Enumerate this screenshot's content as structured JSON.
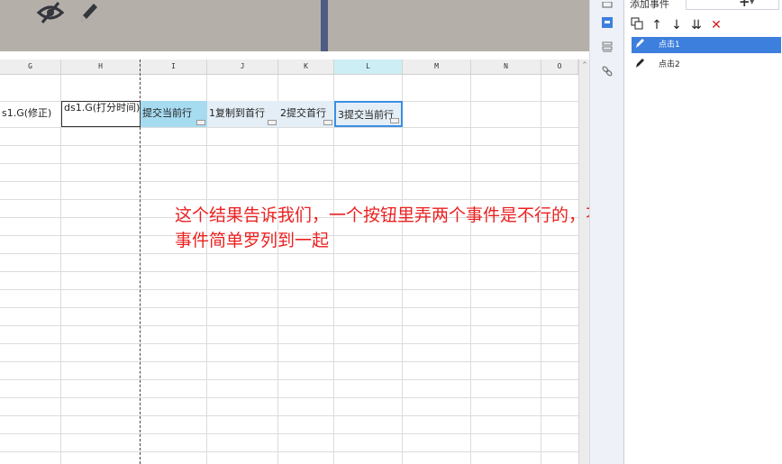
{
  "toolbar": {
    "icons": [
      "eye-slash-icon",
      "pencil-icon"
    ]
  },
  "grid": {
    "columns": [
      "G",
      "H",
      "I",
      "J",
      "K",
      "L",
      "M",
      "N",
      "O"
    ],
    "active_column": "L",
    "cells": {
      "G": "s1.G(修正)",
      "H": "ds1.G(打分时间)",
      "I": "提交当前行",
      "J": "1复制到首行",
      "K": "2提交首行",
      "L": "3提交当前行"
    }
  },
  "annotation": {
    "text": "这个结果告诉我们，一个按钮里弄两个事件是不行的，不能这么简单的把这两个事件简单罗列到一起"
  },
  "side_icons": [
    "panel-icon",
    "event-icon",
    "layers-icon",
    "link-icon"
  ],
  "event_panel": {
    "title": "添加事件",
    "add_label": "+",
    "toolbar_icons": [
      "copy-icon",
      "move-up-icon",
      "move-down-icon",
      "move-bottom-icon",
      "delete-icon"
    ],
    "events": [
      {
        "label": "点击1",
        "selected": true
      },
      {
        "label": "点击2",
        "selected": false
      }
    ]
  },
  "colors": {
    "toolbar_bg": "#b4b0a9",
    "divider": "#4d5c83",
    "selection_blue": "#3a8ee6",
    "annotation_red": "#ec2020",
    "event_selected": "#3d7fdd"
  }
}
